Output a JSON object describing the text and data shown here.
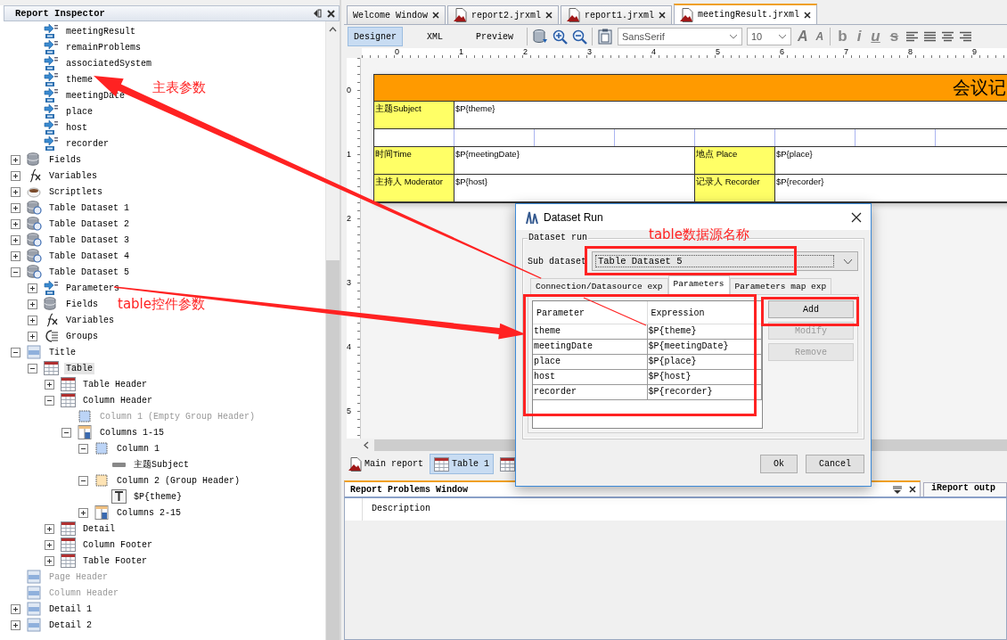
{
  "inspector": {
    "title": "Report Inspector",
    "parameter_items": [
      {
        "label": "meetingResult",
        "kind": "param",
        "selected": false,
        "disabled": false
      },
      {
        "label": "remainProblems",
        "kind": "param",
        "selected": false,
        "disabled": false
      },
      {
        "label": "associatedSystem",
        "kind": "param",
        "selected": false,
        "disabled": false
      },
      {
        "label": "theme",
        "kind": "param",
        "selected": false,
        "disabled": false
      },
      {
        "label": "meetingDate",
        "kind": "param",
        "selected": false,
        "disabled": false
      },
      {
        "label": "place",
        "kind": "param",
        "selected": false,
        "disabled": false
      },
      {
        "label": "host",
        "kind": "param",
        "selected": false,
        "disabled": false
      },
      {
        "label": "recorder",
        "kind": "param",
        "selected": false,
        "disabled": false
      }
    ],
    "nodes": [
      {
        "label": "Fields",
        "kind": "fields",
        "expanded": false,
        "selected": false,
        "disabled": false
      },
      {
        "label": "Variables",
        "kind": "variables",
        "expanded": false,
        "selected": false,
        "disabled": false
      },
      {
        "label": "Scriptlets",
        "kind": "scriptlets",
        "expanded": false,
        "selected": false,
        "disabled": false
      },
      {
        "label": "Table Dataset 1",
        "kind": "dataset",
        "expanded": false,
        "selected": false,
        "disabled": false
      },
      {
        "label": "Table Dataset 2",
        "kind": "dataset",
        "expanded": false,
        "selected": false,
        "disabled": false
      },
      {
        "label": "Table Dataset 3",
        "kind": "dataset",
        "expanded": false,
        "selected": false,
        "disabled": false
      },
      {
        "label": "Table Dataset 4",
        "kind": "dataset",
        "expanded": false,
        "selected": false,
        "disabled": false
      },
      {
        "label": "Table Dataset 5",
        "kind": "dataset",
        "expanded": true,
        "selected": false,
        "disabled": false,
        "children": [
          {
            "label": "Parameters",
            "kind": "param",
            "expanded": false,
            "selected": false,
            "disabled": false
          },
          {
            "label": "Fields",
            "kind": "fields",
            "expanded": false,
            "selected": false,
            "disabled": false
          },
          {
            "label": "Variables",
            "kind": "variables",
            "expanded": false,
            "selected": false,
            "disabled": false
          },
          {
            "label": "Groups",
            "kind": "groups",
            "expanded": false,
            "selected": false,
            "disabled": false
          }
        ]
      },
      {
        "label": "Title",
        "kind": "band",
        "expanded": true,
        "selected": false,
        "disabled": false,
        "children": [
          {
            "label": "Table",
            "kind": "table",
            "expanded": true,
            "selected": true,
            "disabled": false,
            "children": [
              {
                "label": "Table Header",
                "kind": "section",
                "expanded": false,
                "selected": false,
                "disabled": false
              },
              {
                "label": "Column Header",
                "kind": "section",
                "expanded": true,
                "selected": false,
                "disabled": false,
                "children": [
                  {
                    "label": "Column 1 (Empty Group Header)",
                    "kind": "column",
                    "selected": false,
                    "disabled": true
                  },
                  {
                    "label": "Columns 1-15",
                    "kind": "columns",
                    "expanded": true,
                    "selected": false,
                    "disabled": false,
                    "children": [
                      {
                        "label": "Column 1",
                        "kind": "column",
                        "expanded": true,
                        "selected": false,
                        "disabled": false,
                        "children": [
                          {
                            "label": "主题Subject",
                            "kind": "label",
                            "selected": false,
                            "disabled": false
                          }
                        ]
                      },
                      {
                        "label": "Column 2 (Group Header)",
                        "kind": "column-group",
                        "expanded": true,
                        "selected": false,
                        "disabled": false,
                        "children": [
                          {
                            "label": "$P{theme}",
                            "kind": "textfield",
                            "selected": false,
                            "disabled": false
                          }
                        ]
                      },
                      {
                        "label": "Columns 2-15",
                        "kind": "columns",
                        "expanded": false,
                        "selected": false,
                        "disabled": false
                      }
                    ]
                  }
                ]
              },
              {
                "label": "Detail",
                "kind": "section",
                "expanded": false,
                "selected": false,
                "disabled": false
              },
              {
                "label": "Column Footer",
                "kind": "section",
                "expanded": false,
                "selected": false,
                "disabled": false
              },
              {
                "label": "Table Footer",
                "kind": "section",
                "expanded": false,
                "selected": false,
                "disabled": false
              }
            ]
          }
        ]
      },
      {
        "label": "Page Header",
        "kind": "band",
        "selected": false,
        "disabled": true
      },
      {
        "label": "Column Header",
        "kind": "band",
        "selected": false,
        "disabled": true
      },
      {
        "label": "Detail 1",
        "kind": "band",
        "expanded": false,
        "selected": false,
        "disabled": false
      },
      {
        "label": "Detail 2",
        "kind": "band",
        "expanded": false,
        "selected": false,
        "disabled": false
      }
    ]
  },
  "editor_tabs": [
    {
      "label": "Welcome Window",
      "kind": "welcome",
      "selected": false
    },
    {
      "label": "report2.jrxml",
      "kind": "report",
      "selected": false
    },
    {
      "label": "report1.jrxml",
      "kind": "report",
      "selected": false
    },
    {
      "label": "meetingResult.jrxml",
      "kind": "report",
      "selected": true
    }
  ],
  "view_modes": [
    {
      "label": "Designer",
      "selected": true
    },
    {
      "label": "XML",
      "selected": false
    },
    {
      "label": "Preview",
      "selected": false
    }
  ],
  "font_family": "SansSerif",
  "font_size": "10",
  "font_buttons": [
    "A",
    "A"
  ],
  "style_buttons": [
    "b",
    "i",
    "u",
    "s"
  ],
  "ruler": {
    "horizontal": [
      "0",
      "1",
      "2",
      "3",
      "4",
      "5",
      "6",
      "7",
      "8",
      "9"
    ],
    "vertical": [
      "0",
      "1",
      "2",
      "3",
      "4",
      "5"
    ]
  },
  "report": {
    "title": "会议记",
    "rows": [
      {
        "kind": "single",
        "cells": [
          "主题Subject",
          "$P{theme}"
        ]
      },
      {
        "kind": "empty"
      },
      {
        "kind": "double",
        "cells": [
          "时间Time",
          "$P{meetingDate}",
          "地点 Place",
          "$P{place}"
        ]
      },
      {
        "kind": "double",
        "cells": [
          "主持人 Moderator",
          "$P{host}",
          "记录人 Recorder",
          "$P{recorder}"
        ]
      }
    ]
  },
  "bottom_tabs": [
    {
      "label": "Main report",
      "kind": "report",
      "selected": false
    },
    {
      "label": "Table 1",
      "kind": "table",
      "selected": true
    },
    {
      "kind": "table",
      "selected": false
    }
  ],
  "problems": {
    "title": "Report Problems Window",
    "other_tab": "iReport outp",
    "columns": [
      "Description"
    ]
  },
  "dialog": {
    "title": "Dataset Run",
    "group": "Dataset run",
    "sub_dataset_label": "Sub dataset",
    "sub_dataset": "Table Dataset 5",
    "tabs": [
      {
        "label": "Connection/Datasource exp",
        "selected": false
      },
      {
        "label": "Parameters",
        "selected": true
      },
      {
        "label": "Parameters map exp",
        "selected": false
      }
    ],
    "table": {
      "columns": [
        "Parameter",
        "Expression"
      ],
      "rows": [
        [
          "theme",
          "$P{theme}"
        ],
        [
          "meetingDate",
          "$P{meetingDate}"
        ],
        [
          "place",
          "$P{place}"
        ],
        [
          "host",
          "$P{host}"
        ],
        [
          "recorder",
          "$P{recorder}"
        ]
      ]
    },
    "side_buttons": [
      {
        "label": "Add",
        "disabled": false
      },
      {
        "label": "Modify",
        "disabled": true
      },
      {
        "label": "Remove",
        "disabled": true
      }
    ],
    "buttons": [
      "Ok",
      "Cancel"
    ]
  },
  "annotations": {
    "main_params": "主表参数",
    "table_params": "table控件参数",
    "dataset_name": "table数据源名称"
  }
}
